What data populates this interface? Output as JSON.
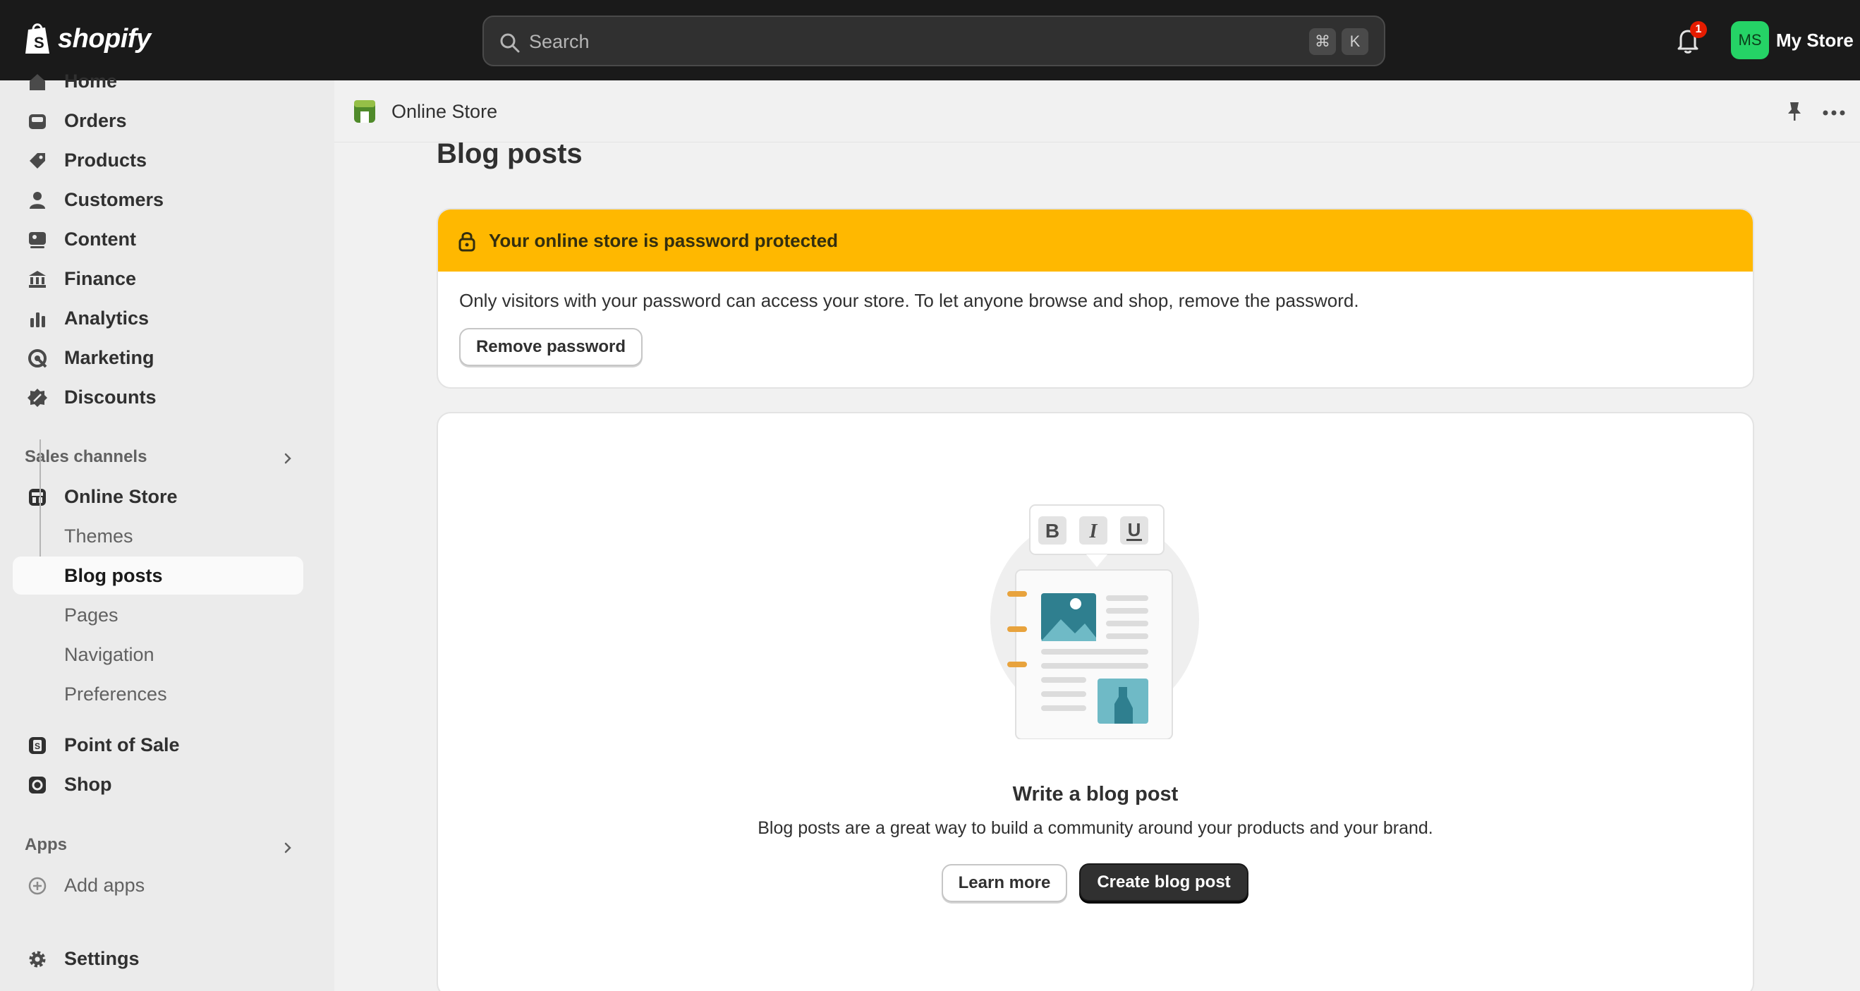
{
  "topbar": {
    "brand": "shopify",
    "search_placeholder": "Search",
    "shortcut_key1": "⌘",
    "shortcut_key2": "K",
    "notification_count": "1",
    "avatar_initials": "MS",
    "store_name": "My Store"
  },
  "sidebar": {
    "items": [
      {
        "label": "Home",
        "icon": "home-icon"
      },
      {
        "label": "Orders",
        "icon": "orders-icon"
      },
      {
        "label": "Products",
        "icon": "tag-icon"
      },
      {
        "label": "Customers",
        "icon": "person-icon"
      },
      {
        "label": "Content",
        "icon": "content-icon"
      },
      {
        "label": "Finance",
        "icon": "bank-icon"
      },
      {
        "label": "Analytics",
        "icon": "bar-chart-icon"
      },
      {
        "label": "Marketing",
        "icon": "target-icon"
      },
      {
        "label": "Discounts",
        "icon": "discount-icon"
      }
    ],
    "sales_channels_title": "Sales channels",
    "online_store": "Online Store",
    "online_store_sub": [
      {
        "label": "Themes"
      },
      {
        "label": "Blog posts"
      },
      {
        "label": "Pages"
      },
      {
        "label": "Navigation"
      },
      {
        "label": "Preferences"
      }
    ],
    "point_of_sale": "Point of Sale",
    "shop": "Shop",
    "apps_title": "Apps",
    "add_apps": "Add apps",
    "settings": "Settings"
  },
  "header": {
    "channel_title": "Online Store"
  },
  "page": {
    "title": "Blog posts"
  },
  "banner": {
    "title": "Your online store is password protected",
    "text": "Only visitors with your password can access your store. To let anyone browse and shop, remove the password.",
    "button": "Remove password"
  },
  "empty_state": {
    "editor_buttons": [
      "B",
      "I",
      "U"
    ],
    "title": "Write a blog post",
    "text": "Blog posts are a great way to build a community around your products and your brand.",
    "learn_more": "Learn more",
    "create": "Create blog post"
  },
  "colors": {
    "topbar": "#1a1a1a",
    "banner_warning": "#ffb800",
    "avatar": "#25d366",
    "badge": "#e51c00",
    "primary_button": "#303030"
  }
}
